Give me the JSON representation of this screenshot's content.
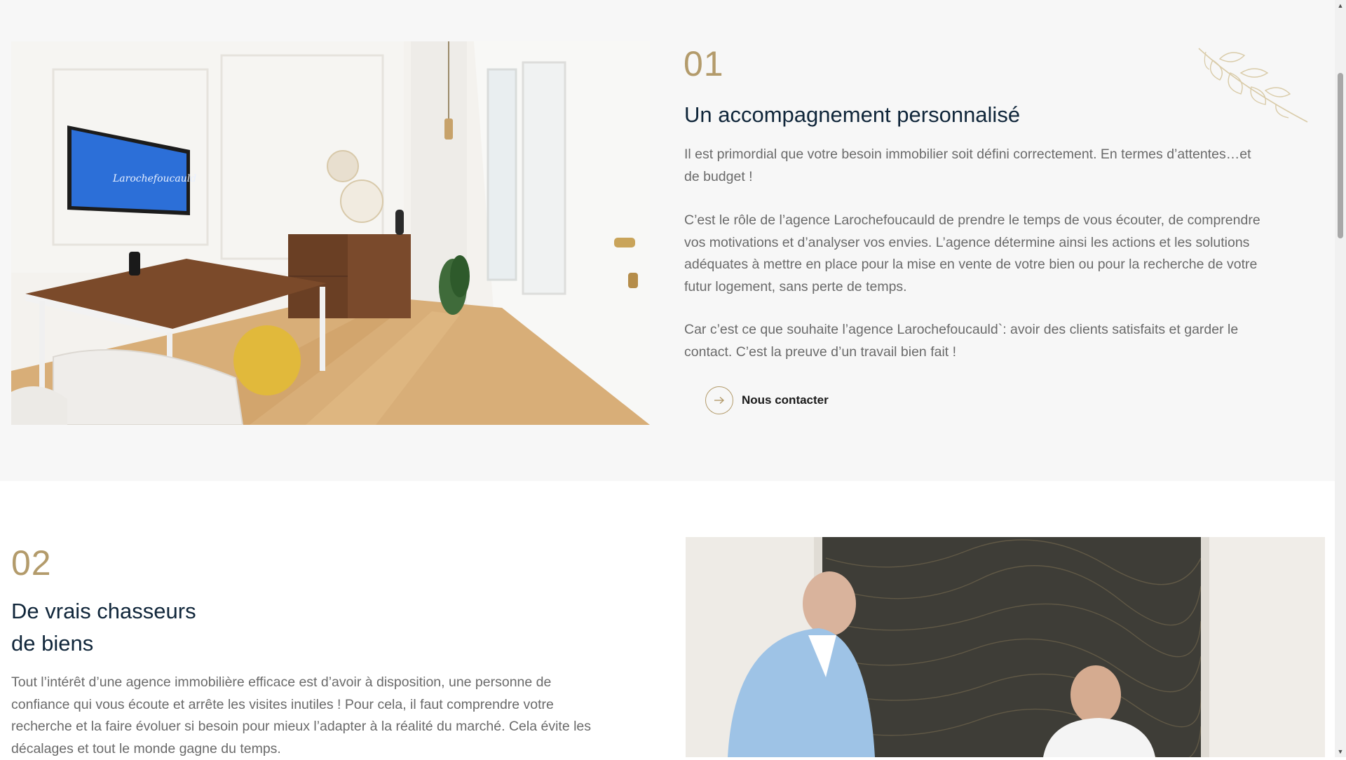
{
  "section1": {
    "number": "01",
    "title": "Un accompagnement personnalisé",
    "paragraphs": [
      "Il est primordial que votre besoin immobilier soit défini correctement. En termes d’attentes…et de budget !",
      "C’est le rôle de l’agence Larochefoucauld de prendre le temps de vous écouter, de comprendre vos motivations et d’analyser vos envies. L’agence détermine ainsi les actions et les solutions adéquates à mettre en place pour la mise en vente de votre bien ou pour la recherche de votre futur logement, sans perte de temps.",
      "Car c’est ce que souhaite l’agence Larochefoucauld`: avoir des clients satisfaits et garder le contact. C’est la preuve d’un travail bien fait !"
    ],
    "cta_label": "Nous contacter",
    "tv_logo_text": "Larochefoucauld"
  },
  "section2": {
    "number": "02",
    "title_line1": "De vrais chasseurs",
    "title_line2": "de biens",
    "paragraph": "Tout l’intérêt d’une agence immobilière efficace est d’avoir à disposition, une personne de confiance qui vous écoute et arrête les visites inutiles ! Pour cela, il faut comprendre votre recherche et la faire évoluer si besoin pour mieux l’adapter à la réalité du marché. Cela évite les décalages et tout le monde gagne du temps."
  },
  "colors": {
    "accent_gold": "#b39b6b",
    "title_navy": "#10263a",
    "body_gray": "#6a6a6a",
    "section_bg": "#f7f7f7"
  },
  "icons": {
    "cta": "arrow-right-icon",
    "decoration": "leaf-branch-icon"
  }
}
